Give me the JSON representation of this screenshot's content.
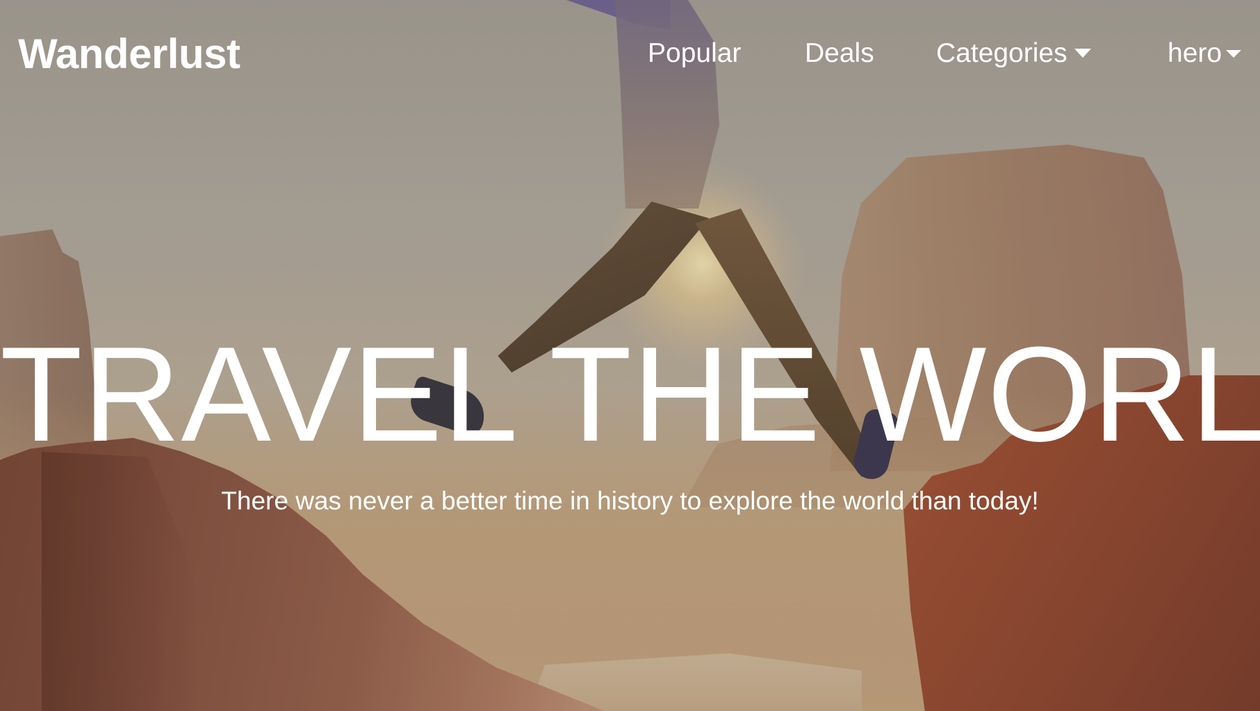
{
  "navbar": {
    "brand": "Wanderlust",
    "links": {
      "popular": "Popular",
      "deals": "Deals",
      "categories": "Categories",
      "hero": "hero"
    }
  },
  "hero": {
    "headline": "TRAVEL THE WORLD",
    "subtitle": "There was never a better time in history to explore the world than today!",
    "background_image": "person-jumping-between-desert-rocks"
  },
  "icons": {
    "categories_dropdown": "caret-down-icon",
    "hero_dropdown": "caret-down-icon"
  },
  "colors": {
    "text": "#ffffff",
    "background_tone": "#b3ada3"
  }
}
